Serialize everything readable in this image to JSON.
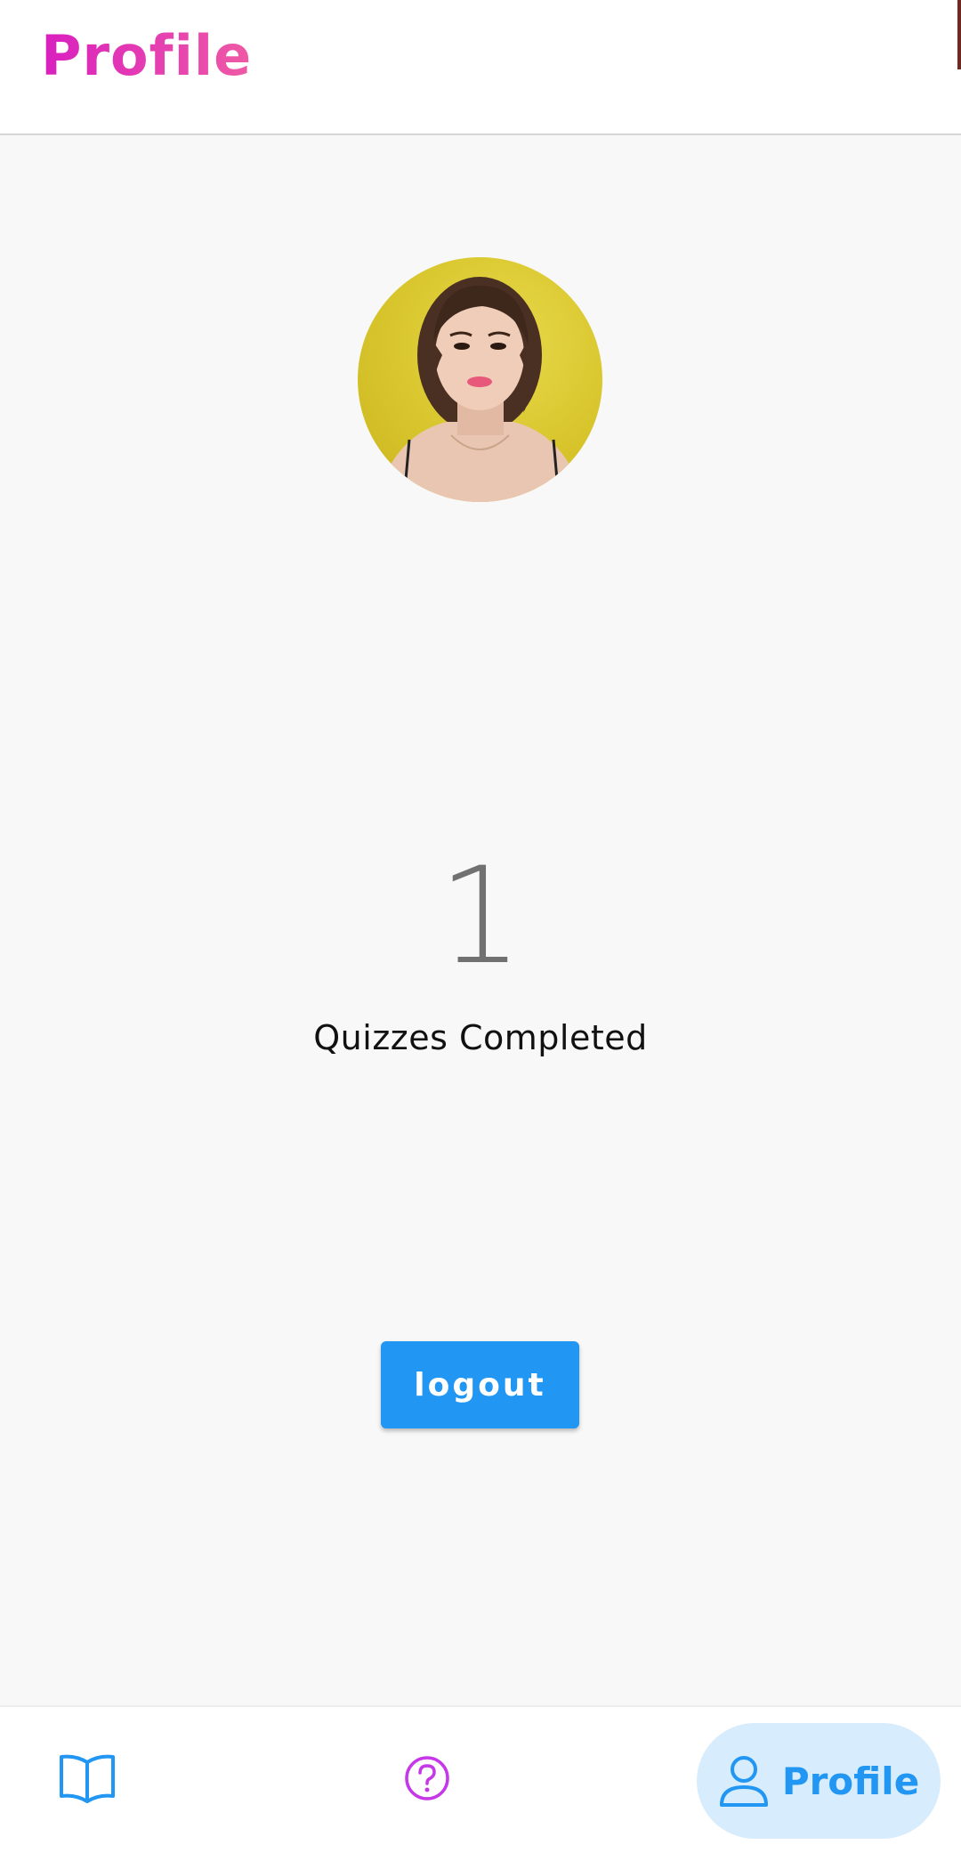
{
  "app_bar": {
    "title": "Profile",
    "title_gradient": [
      "#d91fbf",
      "#ef5aa5"
    ]
  },
  "profile": {
    "avatar_icon": "user-photo",
    "quizzes_completed_count": "1",
    "quizzes_completed_label": "Quizzes Completed",
    "logout_label": "logout"
  },
  "bottom_nav": {
    "items": [
      {
        "icon": "book-open-icon",
        "color": "#2196f3",
        "active": false
      },
      {
        "icon": "help-circle-icon",
        "color": "#c637e8",
        "active": false
      },
      {
        "icon": "user-icon",
        "label": "Profile",
        "color": "#2196f3",
        "active": true
      }
    ],
    "active_pill_color": "#d7ecfc"
  },
  "colors": {
    "accent": "#2196f3",
    "background": "#f8f8f8"
  }
}
